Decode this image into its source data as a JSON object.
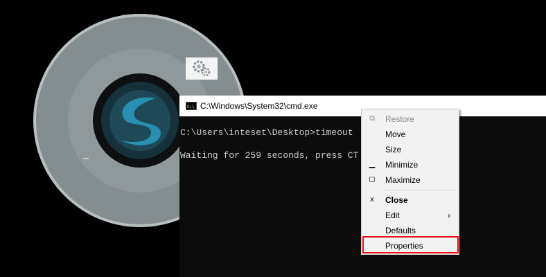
{
  "desktop": {
    "background_color": "#000000",
    "disc_icon": "cd-disc-icon",
    "gear_icon": "gears-icon"
  },
  "cmd_window": {
    "title": "C:\\Windows\\System32\\cmd.exe",
    "icon": "cmd-icon",
    "console_lines": [
      "C:\\Users\\inteset\\Desktop>timeout",
      "Waiting for 259 seconds, press CT"
    ],
    "text_color": "#cccccc",
    "background_color": "#0c0c0c"
  },
  "system_menu": {
    "items": [
      {
        "label": "Restore",
        "icon": "restore-icon",
        "glyph": "⧉",
        "disabled": true
      },
      {
        "label": "Move",
        "glyph": "",
        "disabled": false
      },
      {
        "label": "Size",
        "glyph": "",
        "disabled": false
      },
      {
        "label": "Minimize",
        "icon": "minimize-icon",
        "glyph": "▁",
        "disabled": false
      },
      {
        "label": "Maximize",
        "icon": "maximize-icon",
        "glyph": "◻",
        "disabled": false
      },
      {
        "label": "Close",
        "icon": "close-icon",
        "glyph": "x",
        "disabled": false,
        "bold": true
      },
      {
        "label": "Edit",
        "glyph": "",
        "submenu_arrow": "›",
        "disabled": false
      },
      {
        "label": "Defaults",
        "glyph": "",
        "disabled": false
      },
      {
        "label": "Properties",
        "glyph": "",
        "disabled": false,
        "highlighted": true
      }
    ],
    "highlight_color": "#e8101a"
  }
}
